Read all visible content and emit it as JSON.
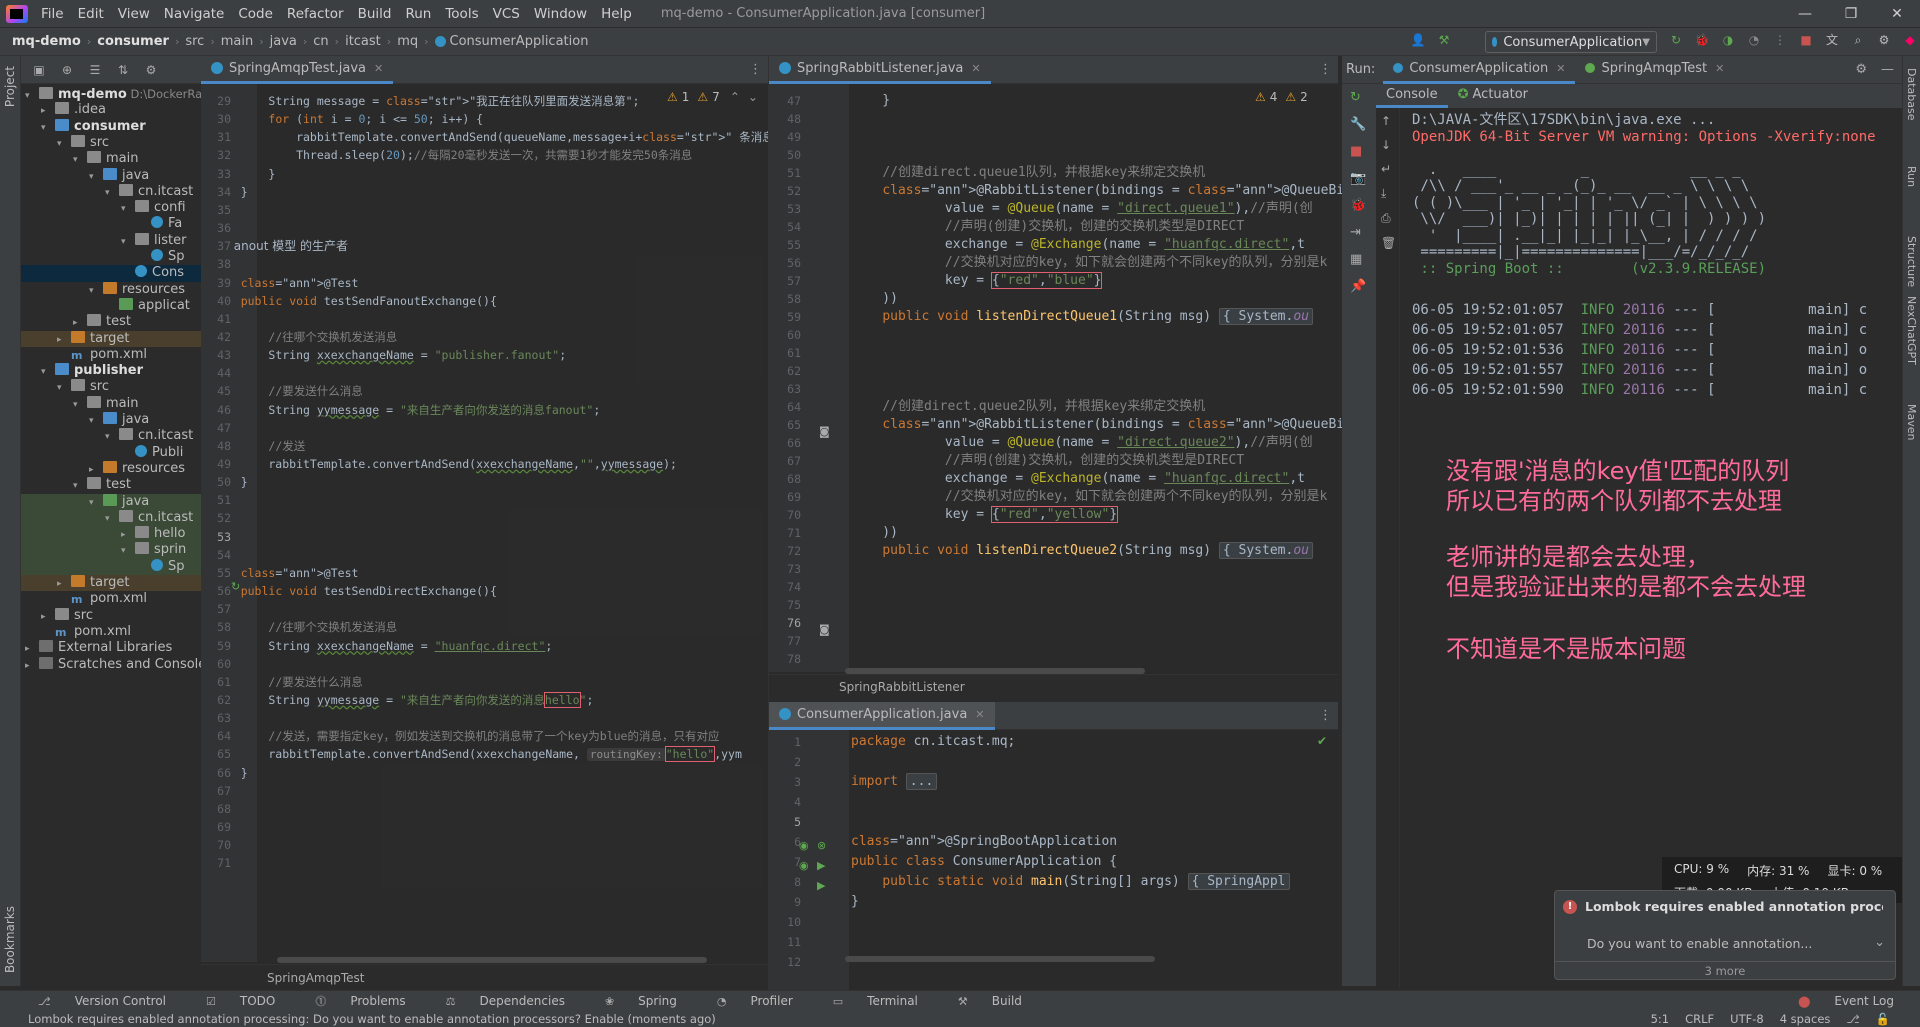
{
  "titlebar": {
    "menus": [
      "File",
      "Edit",
      "View",
      "Navigate",
      "Code",
      "Refactor",
      "Build",
      "Run",
      "Tools",
      "VCS",
      "Window",
      "Help"
    ],
    "window_title": "mq-demo - ConsumerApplication.java [consumer]"
  },
  "navbar": {
    "breadcrumbs": [
      "mq-demo",
      "consumer",
      "src",
      "main",
      "java",
      "cn",
      "itcast",
      "mq",
      "ConsumerApplication"
    ],
    "run_config": "ConsumerApplication"
  },
  "left_strip": {
    "project_label": "Project",
    "bookmarks_label": "Bookmarks"
  },
  "project_tree": {
    "rows": [
      {
        "label": "mq-demo",
        "extra": "D:\\DockerRa",
        "indent": 0,
        "arrow": "▾",
        "icon": "fold",
        "bold": true
      },
      {
        "label": ".idea",
        "indent": 1,
        "arrow": "▸",
        "icon": "fold"
      },
      {
        "label": "consumer",
        "indent": 1,
        "arrow": "▾",
        "icon": "fold-b",
        "bold": true
      },
      {
        "label": "src",
        "indent": 2,
        "arrow": "▾",
        "icon": "fold"
      },
      {
        "label": "main",
        "indent": 3,
        "arrow": "▾",
        "icon": "fold"
      },
      {
        "label": "java",
        "indent": 4,
        "arrow": "▾",
        "icon": "fold-b"
      },
      {
        "label": "cn.itcast",
        "indent": 5,
        "arrow": "▾",
        "icon": "fold"
      },
      {
        "label": "confi",
        "indent": 6,
        "arrow": "▾",
        "icon": "fold"
      },
      {
        "label": "Fa",
        "indent": 7,
        "arrow": "",
        "icon": "cls"
      },
      {
        "label": "lister",
        "indent": 6,
        "arrow": "▾",
        "icon": "fold"
      },
      {
        "label": "Sp",
        "indent": 7,
        "arrow": "",
        "icon": "cls"
      },
      {
        "label": "Cons",
        "indent": 6,
        "arrow": "",
        "icon": "cls",
        "selected": true
      },
      {
        "label": "resources",
        "indent": 4,
        "arrow": "▾",
        "icon": "fold-o"
      },
      {
        "label": "applicat",
        "indent": 5,
        "arrow": "",
        "icon": "fold-g"
      },
      {
        "label": "test",
        "indent": 3,
        "arrow": "▸",
        "icon": "fold"
      },
      {
        "label": "target",
        "indent": 2,
        "arrow": "▸",
        "icon": "fold-o",
        "hl": "orange"
      },
      {
        "label": "pom.xml",
        "indent": 2,
        "arrow": "",
        "icon": "maven"
      },
      {
        "label": "publisher",
        "indent": 1,
        "arrow": "▾",
        "icon": "fold-b",
        "bold": true
      },
      {
        "label": "src",
        "indent": 2,
        "arrow": "▾",
        "icon": "fold"
      },
      {
        "label": "main",
        "indent": 3,
        "arrow": "▾",
        "icon": "fold"
      },
      {
        "label": "java",
        "indent": 4,
        "arrow": "▾",
        "icon": "fold-b"
      },
      {
        "label": "cn.itcast",
        "indent": 5,
        "arrow": "▾",
        "icon": "fold"
      },
      {
        "label": "Publi",
        "indent": 6,
        "arrow": "",
        "icon": "cls"
      },
      {
        "label": "resources",
        "indent": 4,
        "arrow": "▸",
        "icon": "fold-o"
      },
      {
        "label": "test",
        "indent": 3,
        "arrow": "▾",
        "icon": "fold"
      },
      {
        "label": "java",
        "indent": 4,
        "arrow": "▾",
        "icon": "fold-g",
        "hl": "green"
      },
      {
        "label": "cn.itcast",
        "indent": 5,
        "arrow": "▾",
        "icon": "fold",
        "hl": "green"
      },
      {
        "label": "hello",
        "indent": 6,
        "arrow": "▸",
        "icon": "fold",
        "hl": "green"
      },
      {
        "label": "sprin",
        "indent": 6,
        "arrow": "▾",
        "icon": "fold",
        "hl": "green"
      },
      {
        "label": "Sp",
        "indent": 7,
        "arrow": "",
        "icon": "cls",
        "hl": "green"
      },
      {
        "label": "target",
        "indent": 2,
        "arrow": "▸",
        "icon": "fold-o",
        "hl": "orange"
      },
      {
        "label": "pom.xml",
        "indent": 2,
        "arrow": "",
        "icon": "maven"
      },
      {
        "label": "src",
        "indent": 1,
        "arrow": "▸",
        "icon": "fold"
      },
      {
        "label": "pom.xml",
        "indent": 1,
        "arrow": "",
        "icon": "maven"
      },
      {
        "label": "External Libraries",
        "indent": 0,
        "arrow": "▸",
        "icon": "lib"
      },
      {
        "label": "Scratches and Consoles",
        "indent": 0,
        "arrow": "▸",
        "icon": "lib"
      }
    ]
  },
  "editor1": {
    "tab": "SpringAmqpTest.java",
    "inspection": {
      "warnings": "1",
      "weak": "7"
    },
    "footer": "SpringAmqpTest",
    "line_numbers": [
      "29",
      "30",
      "31",
      "32",
      "33",
      "34",
      "35",
      "36",
      "37",
      "38",
      "39",
      "40",
      "41",
      "42",
      "43",
      "44",
      "45",
      "46",
      "47",
      "48",
      "49",
      "50",
      "51",
      "52",
      "53",
      "54",
      "55",
      "56",
      "57",
      "58",
      "59",
      "60",
      "61",
      "62",
      "63",
      "64",
      "65",
      "66",
      "67",
      "68",
      "69",
      "70",
      "71"
    ],
    "lines": [
      "        String message = \"我正在往队列里面发送消息第\";",
      "        for (int i = 0; i <= 50; i++) {",
      "            rabbitTemplate.convertAndSend(queueName,message+i+\" 条消息\");//请",
      "            Thread.sleep(20);//每隔20毫秒发送一次，共需要1秒才能发完50条消息",
      "        }",
      "    }",
      "",
      "",
      "   anout 模型 的生产者",
      "",
      "    @Test",
      "    public void testSendFanoutExchange(){",
      "",
      "        //往哪个交换机发送消息",
      "        String xxexchangeName = \"publisher.fanout\";",
      "",
      "        //要发送什么消息",
      "        String yymessage = \"来自生产者向你发送的消息fanout\";",
      "",
      "        //发送",
      "        rabbitTemplate.convertAndSend(xxexchangeName,\"\",yymessage);",
      "    }",
      "",
      "",
      "",
      "",
      "    @Test",
      "    public void testSendDirectExchange(){",
      "",
      "        //往哪个交换机发送消息",
      "        String xxexchangeName = \"huanfqc.direct\";",
      "",
      "        //要发送什么消息",
      "        String yymessage = \"来自生产者向你发送的消息hello\";",
      "",
      "        //发送，需要指定key，例如发送到交换机的消息带了一个key为blue的消息，只有对应",
      "        rabbitTemplate.convertAndSend(xxexchangeName, routingKey: \"hello\",yym",
      "    }",
      "",
      "",
      "",
      "",
      ""
    ],
    "key_tokens": {
      "hello_box": "hello",
      "routing_hint": "routingKey:",
      "hello_arg": "\"hello\""
    }
  },
  "editor2": {
    "tab": "SpringRabbitListener.java",
    "inspection": {
      "warnings": "4",
      "weak": "2"
    },
    "footer": "SpringRabbitListener",
    "line_numbers": [
      "47",
      "48",
      "49",
      "50",
      "51",
      "52",
      "53",
      "54",
      "55",
      "56",
      "57",
      "58",
      "59",
      "60",
      "61",
      "62",
      "63",
      "64",
      "65",
      "66",
      "67",
      "68",
      "69",
      "70",
      "71",
      "72",
      "73",
      "74",
      "75",
      "76",
      "77",
      "78"
    ],
    "lines": [
      "    }",
      "",
      "",
      "",
      "    //创建direct.queue1队列，并根据key来绑定交换机",
      "    @RabbitListener(bindings = @QueueBinding(",
      "            value = @Queue(name = \"direct.queue1\"),//声明(创",
      "            //声明(创建)交换机，创建的交换机类型是DIRECT",
      "            exchange = @Exchange(name = \"huanfqc.direct\",t",
      "            //交换机对应的key，如下就会创建两个不同key的队列，分别是k",
      "            key = {\"red\",\"blue\"}",
      "    ))",
      "    public void listenDirectQueue1(String msg) { System.ou",
      "",
      "",
      "",
      "",
      "    //创建direct.queue2队列，并根据key来绑定交换机",
      "    @RabbitListener(bindings = @QueueBinding(",
      "            value = @Queue(name = \"direct.queue2\"),//声明(创",
      "            //声明(创建)交换机，创建的交换机类型是DIRECT",
      "            exchange = @Exchange(name = \"huanfqc.direct\",t",
      "            //交换机对应的key，如下就会创建两个不同key的队列，分别是k",
      "            key = {\"red\",\"yellow\"}",
      "    ))",
      "    public void listenDirectQueue2(String msg) { System.ou",
      "",
      "",
      "",
      "",
      "",
      ""
    ]
  },
  "editor3": {
    "tab": "ConsumerApplication.java",
    "line_numbers": [
      "1",
      "2",
      "3",
      "4",
      "5",
      "6",
      "7",
      "8",
      "9",
      "10",
      "11",
      "12"
    ],
    "lines": [
      "package cn.itcast.mq;",
      "",
      "import ...",
      "",
      "",
      "@SpringBootApplication",
      "public class ConsumerApplication {",
      "    public static void main(String[] args) { SpringAppl",
      "}",
      "",
      "",
      ""
    ]
  },
  "run_panel": {
    "label": "Run:",
    "tabs": [
      "ConsumerApplication",
      "SpringAmqpTest"
    ],
    "console_tabs": [
      "Console",
      "Actuator"
    ],
    "lines": [
      {
        "text": "D:\\JAVA-文件区\\17SDK\\bin\\java.exe ...",
        "color": "#a9b7c6"
      },
      {
        "text": "OpenJDK 64-Bit Server VM warning: Options -Xverify:none",
        "color": "#ff6b68"
      },
      {
        "text": "",
        "color": "#a9b7c6"
      },
      {
        "text": "  .   ____          _            __ _ _",
        "color": "#a9b7c6"
      },
      {
        "text": " /\\\\ / ___'_ __ _ _(_)_ __  __ _ \\ \\ \\ \\",
        "color": "#a9b7c6"
      },
      {
        "text": "( ( )\\___ | '_ | '_| | '_ \\/ _` | \\ \\ \\ \\",
        "color": "#a9b7c6"
      },
      {
        "text": " \\\\/  ___)| |_)| | | | | || (_| |  ) ) ) )",
        "color": "#a9b7c6"
      },
      {
        "text": "  '  |____| .__|_| |_|_| |_\\__, | / / / /",
        "color": "#a9b7c6"
      },
      {
        "text": " =========|_|==============|___/=/_/_/_/",
        "color": "#a9b7c6"
      },
      {
        "text": " :: Spring Boot ::        (v2.3.9.RELEASE)",
        "color": "#a9b7c6"
      },
      {
        "text": "",
        "color": "#a9b7c6"
      }
    ],
    "log_rows": [
      {
        "time": "06-05 19:52:01:057",
        "level": "INFO",
        "pid": "20116",
        "rest": " --- [           main] c"
      },
      {
        "time": "06-05 19:52:01:057",
        "level": "INFO",
        "pid": "20116",
        "rest": " --- [           main] c"
      },
      {
        "time": "06-05 19:52:01:536",
        "level": "INFO",
        "pid": "20116",
        "rest": " --- [           main] o"
      },
      {
        "time": "06-05 19:52:01:557",
        "level": "INFO",
        "pid": "20116",
        "rest": " --- [           main] o"
      },
      {
        "time": "06-05 19:52:01:590",
        "level": "INFO",
        "pid": "20116",
        "rest": " --- [           main] c"
      }
    ],
    "annotations": [
      "没有跟'消息的key值'匹配的队列",
      "所以已有的两个队列都不去处理",
      "老师讲的是都会去处理，",
      "但是我验证出来的是都不会去处理",
      "不知道是不是版本问题"
    ]
  },
  "right_strip": [
    "Database",
    "Run",
    "Structure",
    "NexChatGPT",
    "Maven"
  ],
  "hw_monitor": {
    "cpu": "CPU: 9 %",
    "mem": "内存: 31 %",
    "gpu": "显卡: 0 %",
    "down": "下载: 0.00 KB",
    "up": "上传: 0.19 KB"
  },
  "notification": {
    "title": "Lombok requires enabled annotation process",
    "body": "Do you want to enable annotation...",
    "more": "3 more"
  },
  "bottom_tools": [
    "Version Control",
    "TODO",
    "Problems",
    "Dependencies",
    "Spring",
    "Profiler",
    "Terminal",
    "Build"
  ],
  "event_log": "Event Log",
  "status": {
    "message": "Lombok requires enabled annotation processing: Do you want to enable annotation processors? Enable (moments ago)",
    "pos": "5:1",
    "eol": "CRLF",
    "enc": "UTF-8",
    "indent": "4 spaces"
  }
}
